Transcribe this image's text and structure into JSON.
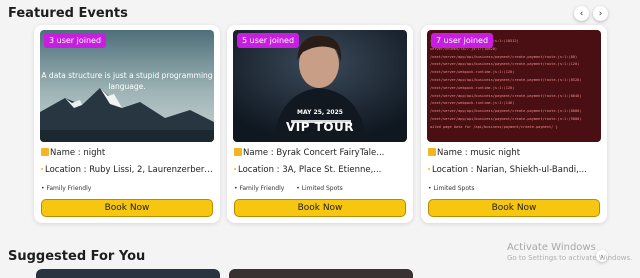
{
  "featured": {
    "title": "Featured Events",
    "events": [
      {
        "badge": "3 user joined",
        "name": "Name : night",
        "location": "Location : Ruby Lissi, 2, Laurenzerberg...",
        "tags": [
          "Family Friendly"
        ],
        "button": "Book Now",
        "image_text": "A data structure is just a stupid programming language."
      },
      {
        "badge": "5 user joined",
        "name": "Name : Byrak Concert FairyTale...",
        "location": "Location : 3A, Place St. Étienne,...",
        "tags": [
          "Family Friendly",
          "Limited Spots"
        ],
        "button": "Book Now",
        "image_text": "MAY 25, 2025",
        "image_title": "VIP TOUR"
      },
      {
        "badge": "7 user joined",
        "name": "Name : music night",
        "location": "Location : Narian, Shiekh-ul-Bandi,...",
        "tags": [
          "Limited Spots"
        ],
        "button": "Book Now",
        "image_lines": [
          "ion/build/server/chunks/7877.js:1:(10512)",
          "server/chunks/7877.js:1:(10820)",
          "/next/server/app/api/business/payment/create-payment/route.js:1:(80)",
          "/next/server/app/api/business/payment/create-payment/route.js:1:(120)",
          "/next/server/webpack-runtime.js:1:(120)",
          "/next/server/app/api/business/payment/create-payment/route.js:1:(8528)",
          "/next/server/webpack-runtime.js:1:(120)",
          "/next/server/app/api/business/payment/create-payment/route.js:1:(8640)",
          "/next/server/webpack-runtime.js:1:(146)",
          "/next/server/app/api/business/payment/create-payment/route.js:1:(8000)",
          "/next/server/app/api/business/payment/create-payment/route.js:1:(9080)",
          "ailed page data for /api/business/payment/create-payment/ }"
        ]
      }
    ]
  },
  "suggested": {
    "title": "Suggested For You"
  },
  "watermark": {
    "line1": "Activate Windows",
    "line2": "Go to Settings to activate Windows."
  },
  "colors": {
    "accent": "#f6c611",
    "badge": "#c71ee2"
  }
}
